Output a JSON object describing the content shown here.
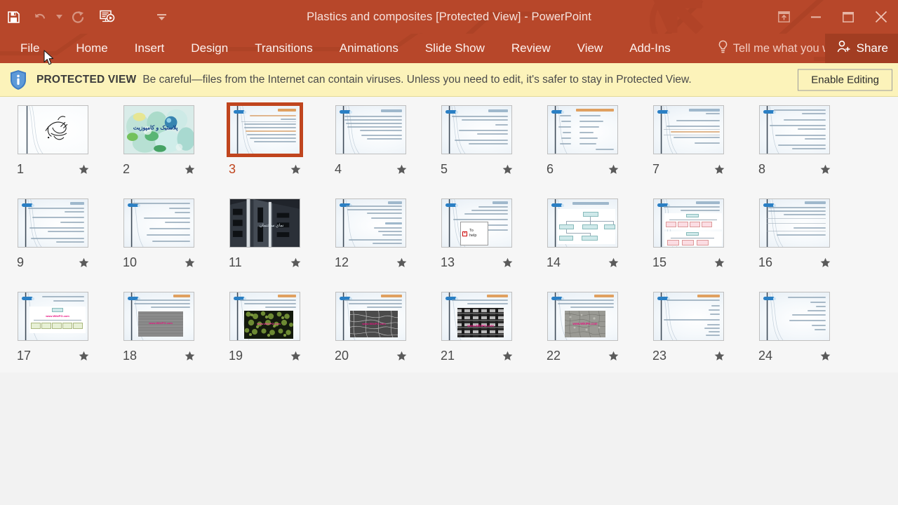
{
  "window": {
    "title": "Plastics and composites [Protected View] - PowerPoint",
    "qat": [
      {
        "name": "save-icon",
        "label": "Save",
        "state": "enabled"
      },
      {
        "name": "undo-icon",
        "label": "Undo",
        "state": "disabled"
      },
      {
        "name": "undo-dropdown-icon",
        "label": "Undo options",
        "state": "disabled"
      },
      {
        "name": "redo-icon",
        "label": "Redo",
        "state": "disabled"
      },
      {
        "name": "start-slideshow-icon",
        "label": "Start From Beginning",
        "state": "enabled"
      },
      {
        "name": "customize-qat-icon",
        "label": "Customize Quick Access Toolbar",
        "state": "enabled"
      }
    ],
    "controls": [
      {
        "name": "ribbon-display-options-icon",
        "label": "Ribbon Display Options"
      },
      {
        "name": "minimize-icon",
        "label": "Minimize"
      },
      {
        "name": "restore-icon",
        "label": "Restore Down"
      },
      {
        "name": "close-icon",
        "label": "Close"
      }
    ]
  },
  "ribbon": {
    "tabs": [
      {
        "label": "File",
        "active": false
      },
      {
        "label": "Home",
        "active": false
      },
      {
        "label": "Insert",
        "active": false
      },
      {
        "label": "Design",
        "active": false
      },
      {
        "label": "Transitions",
        "active": false
      },
      {
        "label": "Animations",
        "active": false
      },
      {
        "label": "Slide Show",
        "active": false
      },
      {
        "label": "Review",
        "active": false
      },
      {
        "label": "View",
        "active": false
      },
      {
        "label": "Add-Ins",
        "active": false
      }
    ],
    "tell_me": "Tell me what you want to do.",
    "share_label": "Share"
  },
  "protected_view": {
    "badge": "PROTECTED VIEW",
    "message": "Be careful—files from the Internet can contain viruses. Unless you need to edit, it's safer to stay in Protected View.",
    "button_label": "Enable Editing"
  },
  "slide_sorter": {
    "selected_slide": 3,
    "slides": [
      {
        "number": "1",
        "kind": "calligraphy"
      },
      {
        "number": "2",
        "kind": "bottles"
      },
      {
        "number": "3",
        "kind": "text-orange-title"
      },
      {
        "number": "4",
        "kind": "text"
      },
      {
        "number": "5",
        "kind": "text"
      },
      {
        "number": "6",
        "kind": "text-table"
      },
      {
        "number": "7",
        "kind": "text"
      },
      {
        "number": "8",
        "kind": "text"
      },
      {
        "number": "9",
        "kind": "text"
      },
      {
        "number": "10",
        "kind": "text"
      },
      {
        "number": "11",
        "kind": "building"
      },
      {
        "number": "12",
        "kind": "text"
      },
      {
        "number": "13",
        "kind": "broken-image"
      },
      {
        "number": "14",
        "kind": "diagram-teal"
      },
      {
        "number": "15",
        "kind": "diagram-pink"
      },
      {
        "number": "16",
        "kind": "text"
      },
      {
        "number": "17",
        "kind": "diagram-green"
      },
      {
        "number": "18",
        "kind": "micrograph-gray"
      },
      {
        "number": "19",
        "kind": "micrograph-green"
      },
      {
        "number": "20",
        "kind": "micrograph-fiber"
      },
      {
        "number": "21",
        "kind": "micrograph-weave"
      },
      {
        "number": "22",
        "kind": "micrograph-speckle"
      },
      {
        "number": "23",
        "kind": "text-orange-title"
      },
      {
        "number": "24",
        "kind": "text"
      }
    ],
    "star_label": "Mark slide"
  },
  "broken_image_slide": {
    "line1": "To",
    "line2": "help"
  },
  "watermark": "www.WikiPG.com",
  "colors": {
    "brand": "#b7472a",
    "selection": "#c0451e",
    "protected_bar": "#fcf3ba",
    "share_button": "#a23d22",
    "panel_background": "#f6f6f6"
  }
}
